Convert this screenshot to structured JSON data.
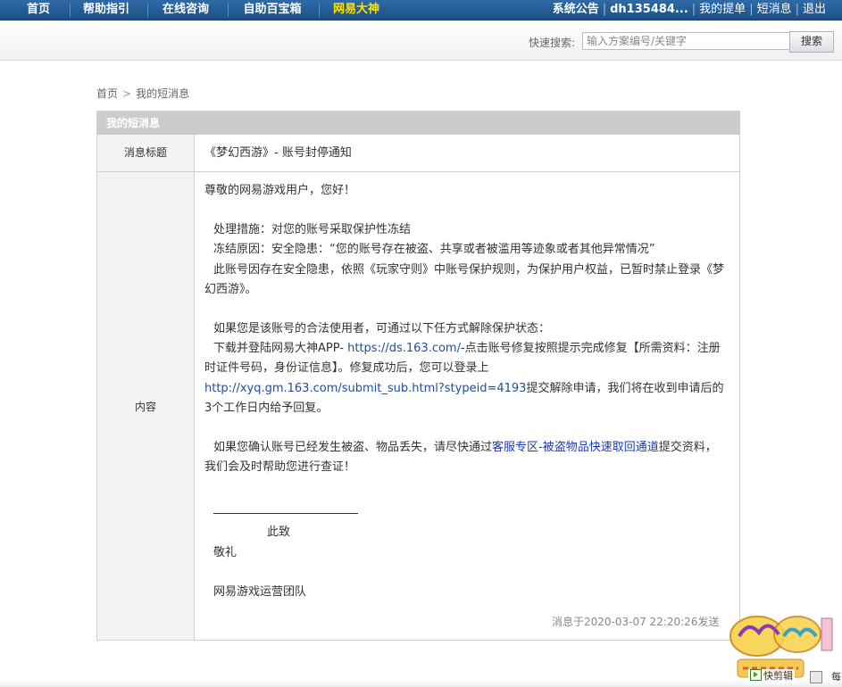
{
  "nav": {
    "items": [
      {
        "label": "首页"
      },
      {
        "label": "帮助指引"
      },
      {
        "label": "在线咨询"
      },
      {
        "label": "自助百宝箱"
      },
      {
        "label": "网易大神"
      }
    ],
    "right": {
      "announcement": "系统公告",
      "user": "dh135484...",
      "my_tickets": "我的提单",
      "messages": "短消息",
      "logout": "退出"
    }
  },
  "search": {
    "label": "快速搜索:",
    "placeholder": "输入方案编号/关键字",
    "button": "搜索"
  },
  "breadcrumb": {
    "home": "首页",
    "sep": ">",
    "current": "我的短消息"
  },
  "panel": {
    "title": "我的短消息",
    "subject_label": "消息标题",
    "subject": "《梦幻西游》- 账号封停通知",
    "content_label": "内容",
    "content": {
      "greeting": "尊敬的网易游戏用户，您好！",
      "measure": "处理措施：对您的账号采取保护性冻结",
      "reason": "冻结原因：安全隐患：“您的账号存在被盗、共享或者被滥用等迹象或者其他异常情况”",
      "rule": "此账号因存在安全隐患，依照《玩家守则》中账号保护规则，为保护用户权益，已暂时禁止登录《梦幻西游》。",
      "legit_intro": "如果您是该账号的合法使用者，可通过以下任方式解除保护状态：",
      "download_pre": "下载并登陆网易大神APP-",
      "download_link": "https://ds.163.com/",
      "download_post": "-点击账号修复按照提示完成修复【所需资料：注册时证件号码，身份证信息】。修复成功后，您可以登录上",
      "submit_link": "http://xyq.gm.163.com/submit_sub.html?stypeid=4193",
      "submit_post": "提交解除申请，我们将在收到申请后的3个工作日内给予回复。",
      "stolen_pre": "如果您确认账号已经发生被盗、物品丢失，请尽快通过",
      "stolen_link": "客服专区-被盗物品快速取回通道",
      "stolen_post": "提交资料，我们会及时帮助您进行查证！",
      "closing1": "此致",
      "closing2": "敬礼",
      "signature": "网易游戏运营团队"
    },
    "timestamp": "消息于2020-03-07 22:20:26发送"
  },
  "bottom": {
    "share_label": "快剪辑",
    "right_text": "每"
  },
  "colors": {
    "nav_bg": "#1d4f86",
    "nav_active": "#ffe100",
    "header_bg": "#cccccc",
    "link": "#1f4e9c"
  }
}
